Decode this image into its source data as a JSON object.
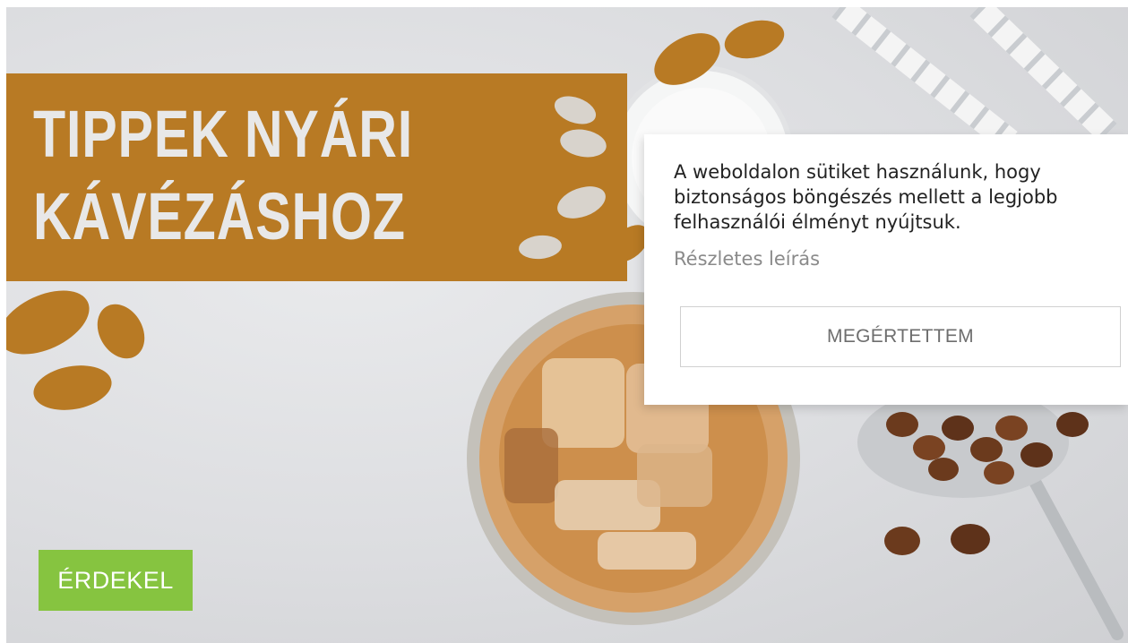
{
  "banner": {
    "headline": [
      "TIPPEK NYÁRI",
      "KÁVÉZÁSHOZ"
    ],
    "cta_label": "ÉRDEKEL"
  },
  "cookie_notice": {
    "message": "A weboldalon sütiket használunk, hogy biztonságos böngészés mellett a legjobb felhasználói élményt nyújtsuk.",
    "details_link": "Részletes leírás",
    "accept_label": "MEGÉRTETTEM"
  },
  "colors": {
    "ribbon": "#b87a24",
    "cta": "#86c440",
    "background": "#dcdde0"
  },
  "icons": [
    "coffee-bean-icon"
  ]
}
